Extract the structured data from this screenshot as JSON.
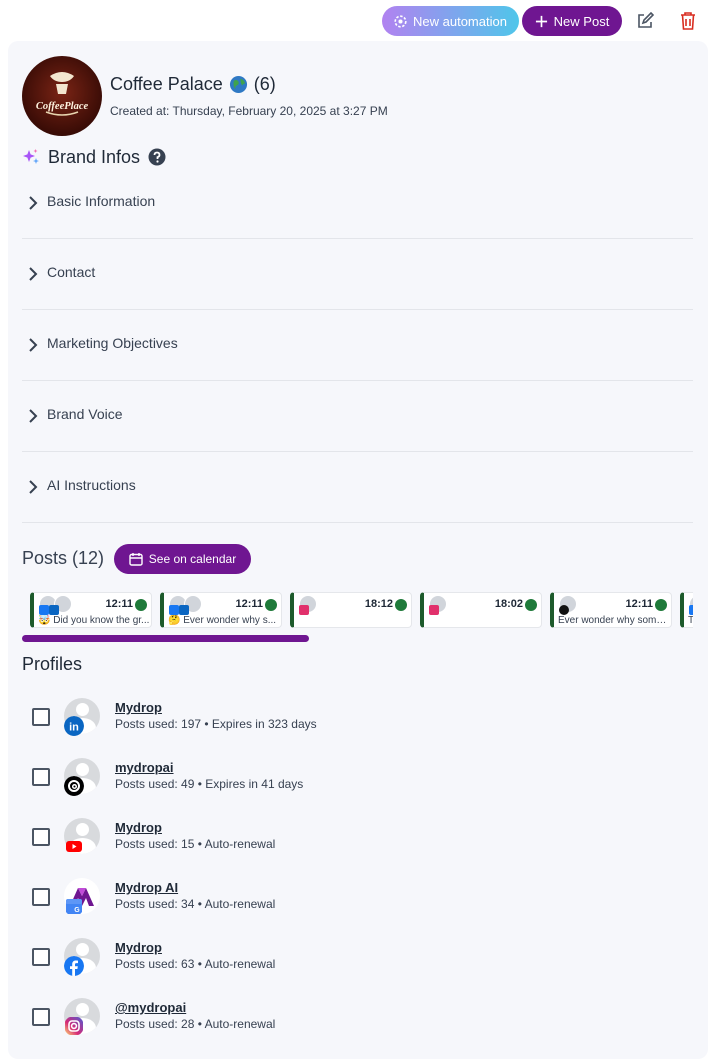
{
  "toolbar": {
    "automation_label": "New automation",
    "new_post_label": "New Post"
  },
  "brand": {
    "name": "Coffee Palace",
    "count": "(6)",
    "created": "Created at: Thursday, February 20, 2025 at 3:27 PM",
    "logo_text": "CoffeePlace"
  },
  "brand_infos": {
    "title": "Brand Infos",
    "sections": [
      {
        "label": "Basic Information"
      },
      {
        "label": "Contact"
      },
      {
        "label": "Marketing Objectives"
      },
      {
        "label": "Brand Voice"
      },
      {
        "label": "AI Instructions"
      }
    ]
  },
  "posts": {
    "title": "Posts (12)",
    "calendar_label": "See on calendar",
    "items": [
      {
        "time": "12:11",
        "text": "🤯 Did you know the gr...",
        "networks": [
          "facebook",
          "linkedin"
        ]
      },
      {
        "time": "12:11",
        "text": "🤔 Ever wonder why s...",
        "networks": [
          "facebook",
          "linkedin"
        ]
      },
      {
        "time": "18:12",
        "text": "",
        "networks": [
          "instagram"
        ]
      },
      {
        "time": "18:02",
        "text": "",
        "networks": [
          "instagram"
        ]
      },
      {
        "time": "12:11",
        "text": "Ever wonder why some...",
        "networks": [
          "threads"
        ]
      },
      {
        "time": "",
        "text": "T",
        "networks": [
          "facebook"
        ]
      }
    ]
  },
  "profiles": {
    "title": "Profiles",
    "items": [
      {
        "name": "Mydrop",
        "meta": "Posts used: 197 • Expires in 323 days",
        "network": "linkedin"
      },
      {
        "name": "mydropai",
        "meta": "Posts used: 49 • Expires in 41 days",
        "network": "threads"
      },
      {
        "name": "Mydrop",
        "meta": "Posts used: 15 • Auto-renewal",
        "network": "youtube"
      },
      {
        "name": "Mydrop AI",
        "meta": "Posts used: 34 • Auto-renewal",
        "network": "google-business"
      },
      {
        "name": "Mydrop",
        "meta": "Posts used: 63 • Auto-renewal",
        "network": "facebook"
      },
      {
        "name": "@mydropai",
        "meta": "Posts used: 28 • Auto-renewal",
        "network": "instagram"
      }
    ]
  },
  "colors": {
    "accent": "#6f1691",
    "card_bg": "#f6f7fb",
    "post_border": "#1e5b2c",
    "delete": "#d92d20"
  }
}
